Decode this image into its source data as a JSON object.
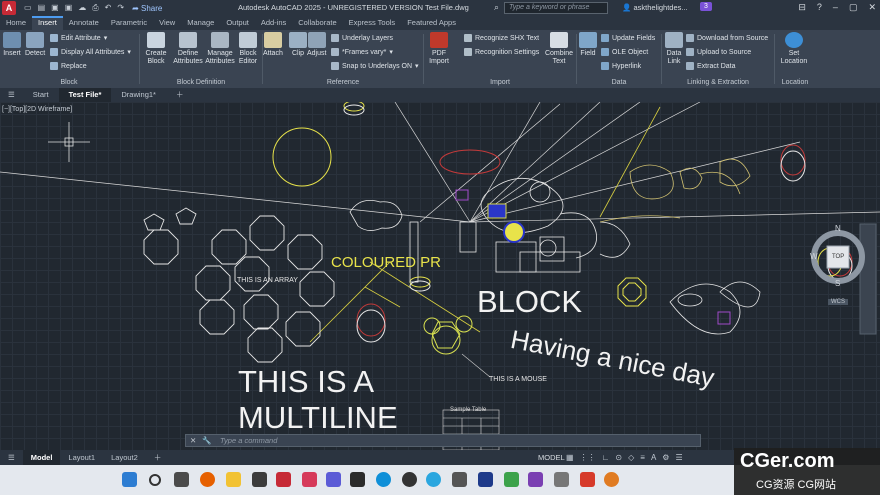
{
  "titlebar": {
    "logo": "A",
    "share": "Share",
    "title": "Autodesk AutoCAD 2025 - UNREGISTERED VERSION     Test File.dwg",
    "search_placeholder": "Type a keyword or phrase",
    "user": "askthelightdes...",
    "badge": "3"
  },
  "ribbon_tabs": [
    "Home",
    "Insert",
    "Annotate",
    "Parametric",
    "View",
    "Manage",
    "Output",
    "Add-ins",
    "Collaborate",
    "Express Tools",
    "Featured Apps"
  ],
  "ribbon": {
    "block_panel": {
      "label": "Block",
      "insert": "Insert",
      "detect": "Detect",
      "edit_attribute": "Edit Attribute",
      "display_all": "Display All Attributes",
      "replace": "Replace"
    },
    "block_def_panel": {
      "label": "Block Definition",
      "create": "Create Block",
      "define": "Define Attributes",
      "manage": "Manage Attributes",
      "editor": "Block Editor"
    },
    "reference_panel": {
      "label": "Reference",
      "attach": "Attach",
      "clip": "Clip",
      "adjust": "Adjust",
      "underlay_layers": "Underlay Layers",
      "frames": "*Frames vary*",
      "snap": "Snap to Underlays ON"
    },
    "import_panel": {
      "label": "Import",
      "pdf": "PDF Import",
      "recognize": "Recognize SHX Text",
      "recog_settings": "Recognition Settings",
      "combine": "Combine Text"
    },
    "data_panel": {
      "label": "Data",
      "field": "Field",
      "update": "Update Fields",
      "ole": "OLE Object",
      "hyperlink": "Hyperlink"
    },
    "linking_panel": {
      "label": "Linking & Extraction",
      "datalink": "Data Link",
      "download": "Download from Source",
      "upload": "Upload to Source",
      "extract": "Extract  Data"
    },
    "location_panel": {
      "label": "Location",
      "set": "Set Location"
    }
  },
  "doc_tabs": [
    "Start",
    "Test File*",
    "Drawing1*"
  ],
  "viewport_label": "[−][Top][2D Wireframe]",
  "viewcube": {
    "n": "N",
    "s": "S",
    "w": "W",
    "top": "TOP",
    "wcs": "WCS"
  },
  "drawing_text": {
    "coloured": "COLOURED PR",
    "array": "THIS IS AN ARRAY",
    "block": "BLOCK",
    "nice_day": "Having a nice day",
    "multiline1": "THIS IS A",
    "multiline2": "MULTILINE",
    "mouse": "THIS IS A MOUSE",
    "table": "Sample Table"
  },
  "command_placeholder": "Type a command",
  "status": {
    "tabs": [
      "Model",
      "Layout1",
      "Layout2"
    ],
    "model": "MODEL"
  },
  "watermark": {
    "main": "CGer.com",
    "sub": "CG资源 CG网站"
  }
}
